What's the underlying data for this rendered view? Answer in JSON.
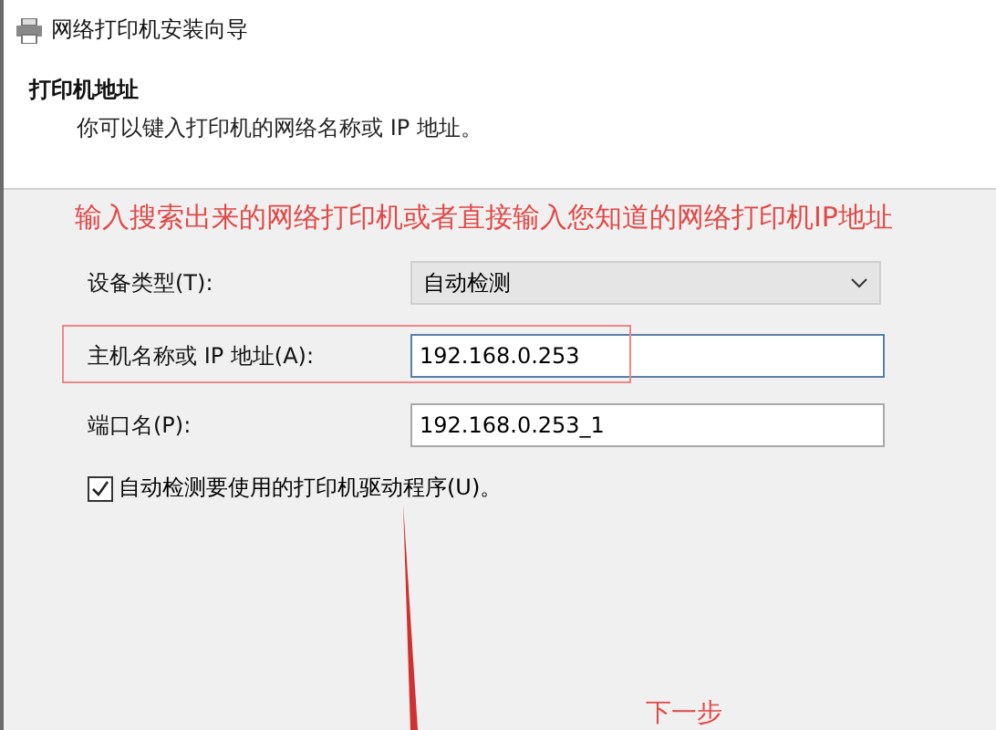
{
  "window": {
    "title": "网络打印机安装向导"
  },
  "header": {
    "heading": "打印机地址",
    "subtitle": "你可以键入打印机的网络名称或 IP 地址。"
  },
  "annotation": {
    "instruction": "输入搜索出来的网络打印机或者直接输入您知道的网络打印机IP地址",
    "next_hint": "下一步"
  },
  "fields": [
    {
      "kind": "dropdown",
      "label": "设备类型(T):",
      "value": "自动检测",
      "highlighted": false
    },
    {
      "kind": "text",
      "label": "主机名称或 IP 地址(A):",
      "value": "192.168.0.253",
      "highlighted": true
    },
    {
      "kind": "text",
      "label": "端口名(P):",
      "value": "192.168.0.253_1",
      "highlighted": false
    }
  ],
  "auto_detect": {
    "label": "自动检测要使用的打印机驱动程序(U)。",
    "checked": true
  }
}
